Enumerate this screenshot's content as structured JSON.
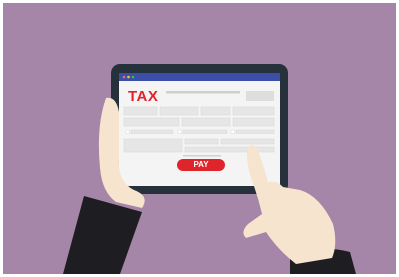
{
  "form": {
    "title": "TAX",
    "pay_label": "PAY"
  },
  "colors": {
    "background": "#a585a8",
    "tablet_frame": "#27313c",
    "titlebar": "#3b4fa8",
    "screen": "#f4f4f4",
    "field": "#e6e6e6",
    "accent": "#e0242b",
    "skin": "#f6e4cf",
    "sleeve": "#1e1e22"
  },
  "icons": [
    "window-dots-icon"
  ]
}
